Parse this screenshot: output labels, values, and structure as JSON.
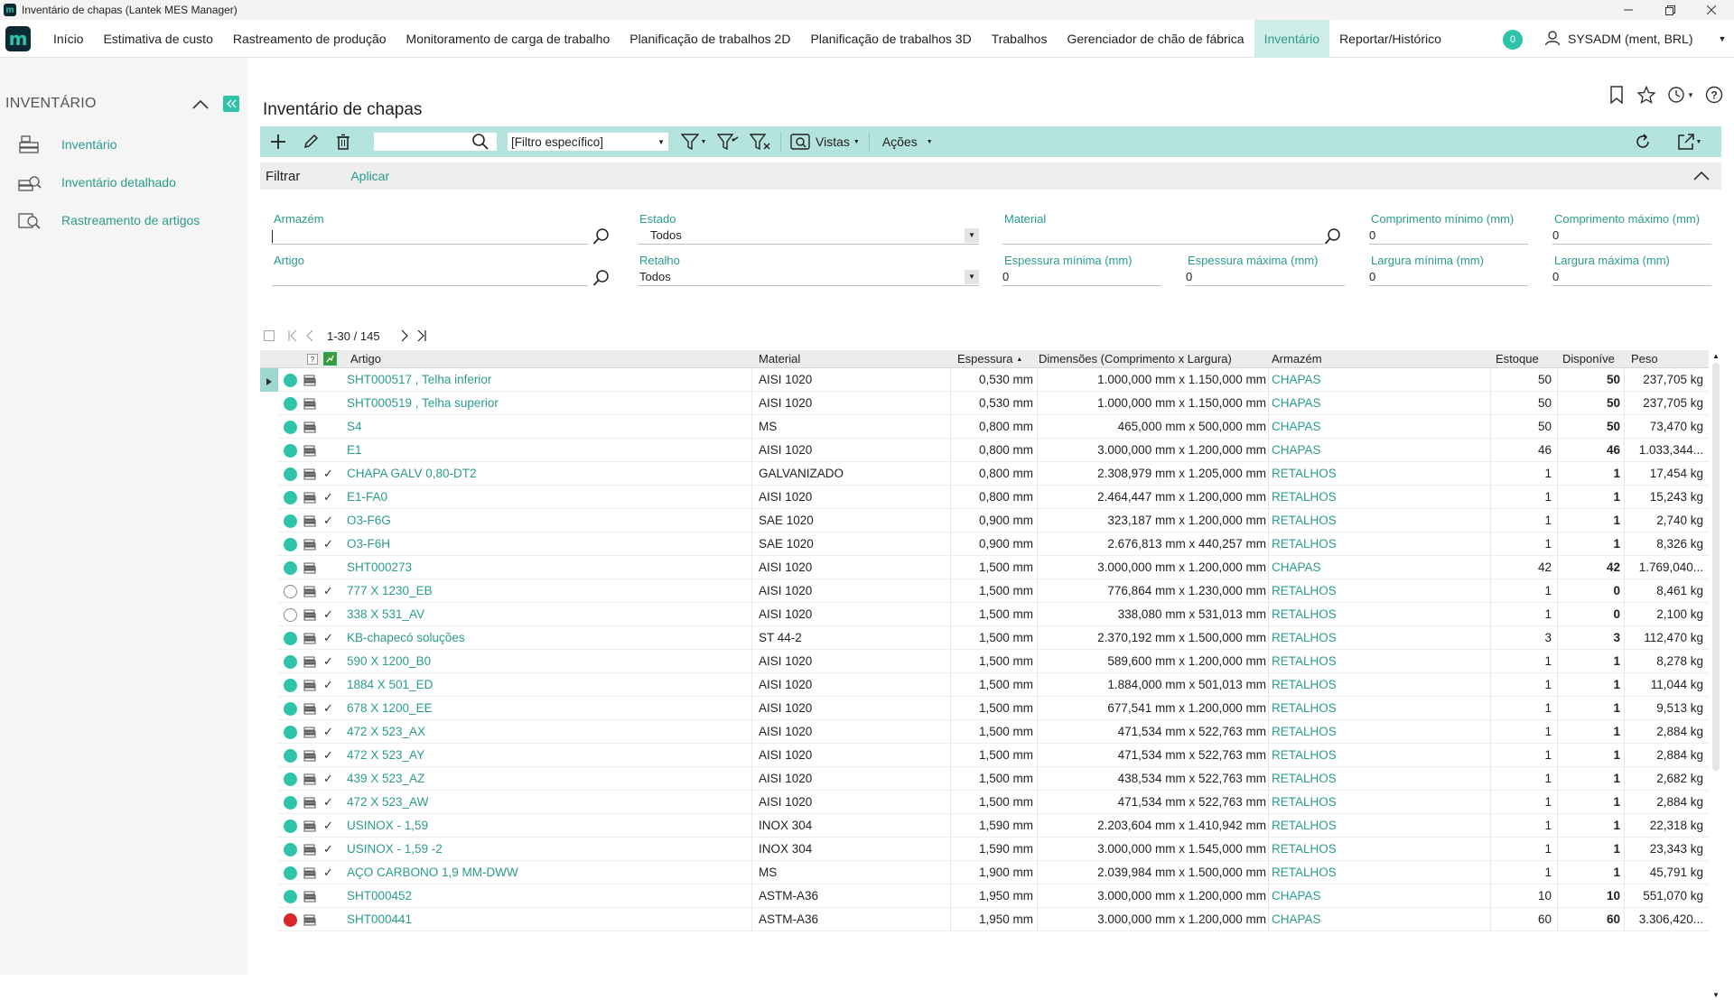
{
  "window": {
    "title": "Inventário de chapas (Lantek MES Manager)"
  },
  "menu": {
    "logo": "m",
    "items": [
      "Início",
      "Estimativa de custo",
      "Rastreamento de produção",
      "Monitoramento de carga de trabalho",
      "Planificação de trabalhos 2D",
      "Planificação de trabalhos 3D",
      "Trabalhos",
      "Gerenciador de chão de fábrica",
      "Inventário",
      "Reportar/Histórico"
    ],
    "active_index": 8,
    "notifications": "0",
    "user": "SYSADM (ment, BRL)"
  },
  "sidebar": {
    "title": "INVENTÁRIO",
    "items": [
      {
        "label": "Inventário",
        "icon": "inventory-icon"
      },
      {
        "label": "Inventário detalhado",
        "icon": "detailed-inventory-icon"
      },
      {
        "label": "Rastreamento de artigos",
        "icon": "article-tracking-icon"
      }
    ]
  },
  "page": {
    "title": "Inventário de chapas"
  },
  "toolbar": {
    "search_value": "",
    "filter_select": "[Filtro específico]",
    "views_label": "Vistas",
    "actions_label": "Ações"
  },
  "filterbar": {
    "label": "Filtrar",
    "apply": "Aplicar"
  },
  "filters": {
    "armazem": {
      "label": "Armazém",
      "value": ""
    },
    "estado": {
      "label": "Estado",
      "value": "Todos"
    },
    "material": {
      "label": "Material",
      "value": ""
    },
    "comp_min": {
      "label": "Comprimento mínimo (mm)",
      "value": "0"
    },
    "comp_max": {
      "label": "Comprimento máximo (mm)",
      "value": "0"
    },
    "artigo": {
      "label": "Artigo",
      "value": ""
    },
    "retalho": {
      "label": "Retalho",
      "value": "Todos"
    },
    "esp_min": {
      "label": "Espessura mínima (mm)",
      "value": "0"
    },
    "esp_max": {
      "label": "Espessura máxima (mm)",
      "value": "0"
    },
    "larg_min": {
      "label": "Largura mínima (mm)",
      "value": "0"
    },
    "larg_max": {
      "label": "Largura máxima (mm)",
      "value": "0"
    }
  },
  "pager": {
    "range": "1-30 / 145"
  },
  "grid": {
    "columns": {
      "artigo": "Artigo",
      "material": "Material",
      "espessura": "Espessura",
      "dimensoes": "Dimensões (Comprimento x Largura)",
      "armazem": "Armazém",
      "estoque": "Estoque",
      "disponivel": "Disponíve",
      "peso": "Peso"
    },
    "help_marker": "?",
    "status_colors": {
      "green": "#2fc3a8",
      "red": "#d9262c",
      "empty": "#ffffff"
    },
    "rows": [
      {
        "status": "green",
        "check": "",
        "artigo": "SHT000517 , Telha inferior",
        "material": "AISI 1020",
        "espessura": "0,530 mm",
        "dim": "1.000,000 mm x 1.150,000 mm",
        "armazem": "CHAPAS",
        "estoque": "50",
        "disp": "50",
        "peso": "237,705 kg",
        "selected": true
      },
      {
        "status": "green",
        "check": "",
        "artigo": "SHT000519 , Telha superior",
        "material": "AISI 1020",
        "espessura": "0,530 mm",
        "dim": "1.000,000 mm x 1.150,000 mm",
        "armazem": "CHAPAS",
        "estoque": "50",
        "disp": "50",
        "peso": "237,705 kg"
      },
      {
        "status": "green",
        "check": "",
        "artigo": "S4",
        "material": "MS",
        "espessura": "0,800 mm",
        "dim": "465,000 mm x 500,000 mm",
        "armazem": "CHAPAS",
        "estoque": "50",
        "disp": "50",
        "peso": "73,470 kg"
      },
      {
        "status": "green",
        "check": "",
        "artigo": "E1",
        "material": "AISI 1020",
        "espessura": "0,800 mm",
        "dim": "3.000,000 mm x 1.200,000 mm",
        "armazem": "CHAPAS",
        "estoque": "46",
        "disp": "46",
        "peso": "1.033,344..."
      },
      {
        "status": "green",
        "check": "✓",
        "artigo": "CHAPA GALV  0,80-DT2",
        "material": "GALVANIZADO",
        "espessura": "0,800 mm",
        "dim": "2.308,979 mm x 1.205,000 mm",
        "armazem": "RETALHOS",
        "estoque": "1",
        "disp": "1",
        "peso": "17,454 kg"
      },
      {
        "status": "green",
        "check": "✓",
        "artigo": "E1-FA0",
        "material": "AISI 1020",
        "espessura": "0,800 mm",
        "dim": "2.464,447 mm x 1.200,000 mm",
        "armazem": "RETALHOS",
        "estoque": "1",
        "disp": "1",
        "peso": "15,243 kg"
      },
      {
        "status": "green",
        "check": "✓",
        "artigo": "O3-F6G",
        "material": "SAE 1020",
        "espessura": "0,900 mm",
        "dim": "323,187 mm x 1.200,000 mm",
        "armazem": "RETALHOS",
        "estoque": "1",
        "disp": "1",
        "peso": "2,740 kg"
      },
      {
        "status": "green",
        "check": "✓",
        "artigo": "O3-F6H",
        "material": "SAE 1020",
        "espessura": "0,900 mm",
        "dim": "2.676,813 mm x 440,257 mm",
        "armazem": "RETALHOS",
        "estoque": "1",
        "disp": "1",
        "peso": "8,326 kg"
      },
      {
        "status": "green",
        "check": "",
        "artigo": "SHT000273",
        "material": "AISI 1020",
        "espessura": "1,500 mm",
        "dim": "3.000,000 mm x 1.200,000 mm",
        "armazem": "CHAPAS",
        "estoque": "42",
        "disp": "42",
        "peso": "1.769,040..."
      },
      {
        "status": "empty",
        "check": "✓",
        "artigo": "777 X 1230_EB",
        "material": "AISI 1020",
        "espessura": "1,500 mm",
        "dim": "776,864 mm x 1.230,000 mm",
        "armazem": "RETALHOS",
        "estoque": "1",
        "disp": "0",
        "peso": "8,461 kg"
      },
      {
        "status": "empty",
        "check": "✓",
        "artigo": "338 X 531_AV",
        "material": "AISI 1020",
        "espessura": "1,500 mm",
        "dim": "338,080 mm x 531,013 mm",
        "armazem": "RETALHOS",
        "estoque": "1",
        "disp": "0",
        "peso": "2,100 kg"
      },
      {
        "status": "green",
        "check": "✓",
        "artigo": "KB-chapecó soluções",
        "material": "ST 44-2",
        "espessura": "1,500 mm",
        "dim": "2.370,192 mm x 1.500,000 mm",
        "armazem": "RETALHOS",
        "estoque": "3",
        "disp": "3",
        "peso": "112,470 kg"
      },
      {
        "status": "green",
        "check": "✓",
        "artigo": "590 X 1200_B0",
        "material": "AISI 1020",
        "espessura": "1,500 mm",
        "dim": "589,600 mm x 1.200,000 mm",
        "armazem": "RETALHOS",
        "estoque": "1",
        "disp": "1",
        "peso": "8,278 kg"
      },
      {
        "status": "green",
        "check": "✓",
        "artigo": "1884 X 501_ED",
        "material": "AISI 1020",
        "espessura": "1,500 mm",
        "dim": "1.884,000 mm x 501,013 mm",
        "armazem": "RETALHOS",
        "estoque": "1",
        "disp": "1",
        "peso": "11,044 kg"
      },
      {
        "status": "green",
        "check": "✓",
        "artigo": "678 X 1200_EE",
        "material": "AISI 1020",
        "espessura": "1,500 mm",
        "dim": "677,541 mm x 1.200,000 mm",
        "armazem": "RETALHOS",
        "estoque": "1",
        "disp": "1",
        "peso": "9,513 kg"
      },
      {
        "status": "green",
        "check": "✓",
        "artigo": "472 X 523_AX",
        "material": "AISI 1020",
        "espessura": "1,500 mm",
        "dim": "471,534 mm x 522,763 mm",
        "armazem": "RETALHOS",
        "estoque": "1",
        "disp": "1",
        "peso": "2,884 kg"
      },
      {
        "status": "green",
        "check": "✓",
        "artigo": "472 X 523_AY",
        "material": "AISI 1020",
        "espessura": "1,500 mm",
        "dim": "471,534 mm x 522,763 mm",
        "armazem": "RETALHOS",
        "estoque": "1",
        "disp": "1",
        "peso": "2,884 kg"
      },
      {
        "status": "green",
        "check": "✓",
        "artigo": "439 X 523_AZ",
        "material": "AISI 1020",
        "espessura": "1,500 mm",
        "dim": "438,534 mm x 522,763 mm",
        "armazem": "RETALHOS",
        "estoque": "1",
        "disp": "1",
        "peso": "2,682 kg"
      },
      {
        "status": "green",
        "check": "✓",
        "artigo": "472 X 523_AW",
        "material": "AISI 1020",
        "espessura": "1,500 mm",
        "dim": "471,534 mm x 522,763 mm",
        "armazem": "RETALHOS",
        "estoque": "1",
        "disp": "1",
        "peso": "2,884 kg"
      },
      {
        "status": "green",
        "check": "✓",
        "artigo": "USINOX - 1,59",
        "material": "INOX 304",
        "espessura": "1,590 mm",
        "dim": "2.203,604 mm x 1.410,942 mm",
        "armazem": "RETALHOS",
        "estoque": "1",
        "disp": "1",
        "peso": "22,318 kg"
      },
      {
        "status": "green",
        "check": "✓",
        "artigo": "USINOX - 1,59 -2",
        "material": "INOX 304",
        "espessura": "1,590 mm",
        "dim": "3.000,000 mm x 1.545,000 mm",
        "armazem": "RETALHOS",
        "estoque": "1",
        "disp": "1",
        "peso": "23,343 kg"
      },
      {
        "status": "green",
        "check": "✓",
        "artigo": "AÇO CARBONO 1,9 MM-DWW",
        "material": "MS",
        "espessura": "1,900 mm",
        "dim": "2.039,984 mm x 1.500,000 mm",
        "armazem": "RETALHOS",
        "estoque": "1",
        "disp": "1",
        "peso": "45,791 kg"
      },
      {
        "status": "green",
        "check": "",
        "artigo": "SHT000452",
        "material": "ASTM-A36",
        "espessura": "1,950 mm",
        "dim": "3.000,000 mm x 1.200,000 mm",
        "armazem": "CHAPAS",
        "estoque": "10",
        "disp": "10",
        "peso": "551,070 kg"
      },
      {
        "status": "red",
        "check": "",
        "artigo": "SHT000441",
        "material": "ASTM-A36",
        "espessura": "1,950 mm",
        "dim": "3.000,000 mm x 1.200,000 mm",
        "armazem": "CHAPAS",
        "estoque": "60",
        "disp": "60",
        "peso": "3.306,420..."
      }
    ]
  }
}
